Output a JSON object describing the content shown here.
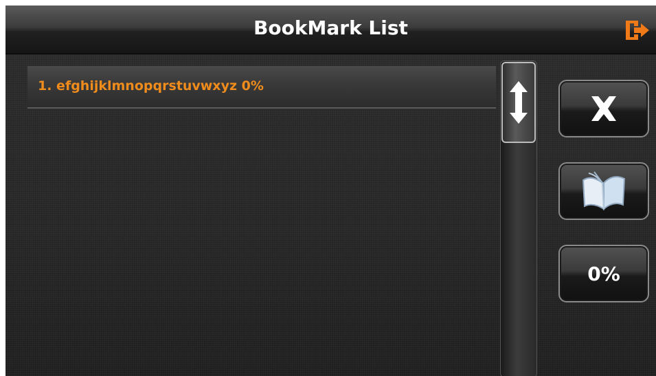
{
  "header": {
    "title": "BookMark List",
    "exit_icon": "exit-icon"
  },
  "bookmarks": [
    {
      "label": "1. efghijklmnopqrstuvwxyz 0%"
    }
  ],
  "sidebar": {
    "delete_icon": "close-icon",
    "open_icon": "book-icon",
    "percent_label": "0%"
  },
  "colors": {
    "accent": "#f08c1c",
    "text": "#ffffff",
    "background": "#262626"
  }
}
